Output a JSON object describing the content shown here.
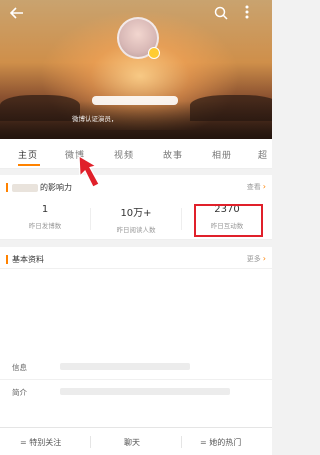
{
  "topbar": {
    "back_icon": "back-arrow-icon",
    "search_icon": "search-icon",
    "more_icon": "more-vertical-icon"
  },
  "profile": {
    "verification_text": "微博认证演员，"
  },
  "tabs": [
    {
      "label": "主页",
      "active": true
    },
    {
      "label": "微博",
      "active": false
    },
    {
      "label": "视频",
      "active": false
    },
    {
      "label": "故事",
      "active": false
    },
    {
      "label": "相册",
      "active": false
    },
    {
      "label": "超",
      "active": false
    }
  ],
  "influence": {
    "title": "的影响力",
    "more_label": "查看",
    "stats": [
      {
        "value": "1",
        "label": "昨日发博数"
      },
      {
        "value": "10万+",
        "label": "昨日阅读人数"
      },
      {
        "value": "2370",
        "label": "昨日互动数"
      }
    ]
  },
  "basic_info": {
    "title": "基本资料",
    "more_label": "更多",
    "rows": [
      {
        "label": "信息"
      },
      {
        "label": "简介"
      }
    ]
  },
  "bottom_bar": {
    "items": [
      {
        "label": "特别关注",
        "prefix": "="
      },
      {
        "label": "聊天",
        "prefix": ""
      },
      {
        "label": "她的热门",
        "prefix": "="
      }
    ]
  },
  "colors": {
    "accent": "#ff8200",
    "highlight": "#e0202a"
  }
}
